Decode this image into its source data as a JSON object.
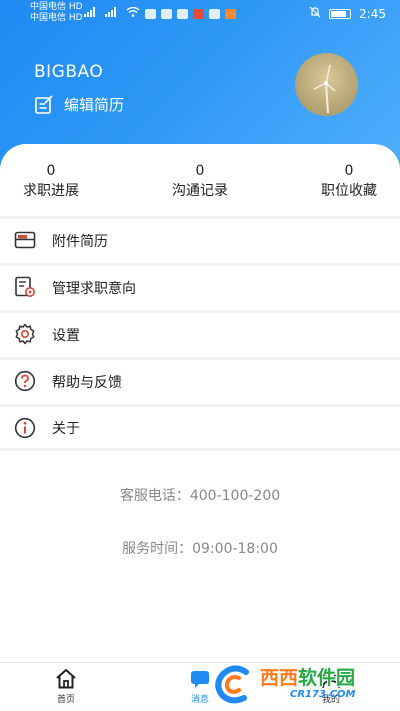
{
  "status_bar": {
    "carrier1": "中国电信",
    "carrier1_badge": "HD",
    "carrier2": "中国电信",
    "carrier2_badge": "HD",
    "time": "2:45"
  },
  "profile": {
    "username": "BIGBAO",
    "edit_resume_label": "编辑简历"
  },
  "stats": [
    {
      "value": "0",
      "label": "求职进展"
    },
    {
      "value": "0",
      "label": "沟通记录"
    },
    {
      "value": "0",
      "label": "职位收藏"
    }
  ],
  "menu": [
    {
      "label": "附件简历",
      "icon": "folder-icon"
    },
    {
      "label": "管理求职意向",
      "icon": "document-settings-icon"
    },
    {
      "label": "设置",
      "icon": "gear-icon"
    },
    {
      "label": "帮助与反馈",
      "icon": "help-icon"
    },
    {
      "label": "关于",
      "icon": "info-icon"
    }
  ],
  "contact": {
    "phone_line": "客服电话：400-100-200",
    "hours_line": "服务时间：09:00-18:00"
  },
  "tabbar": {
    "home_label": "首页",
    "messages_label": "消息",
    "mine_label": "我的"
  },
  "watermark": {
    "title_a": "西西",
    "title_b": "软件园",
    "subtitle": "CR173.COM"
  },
  "colors": {
    "accent": "#1f8af2",
    "icon_red": "#d0473c"
  }
}
